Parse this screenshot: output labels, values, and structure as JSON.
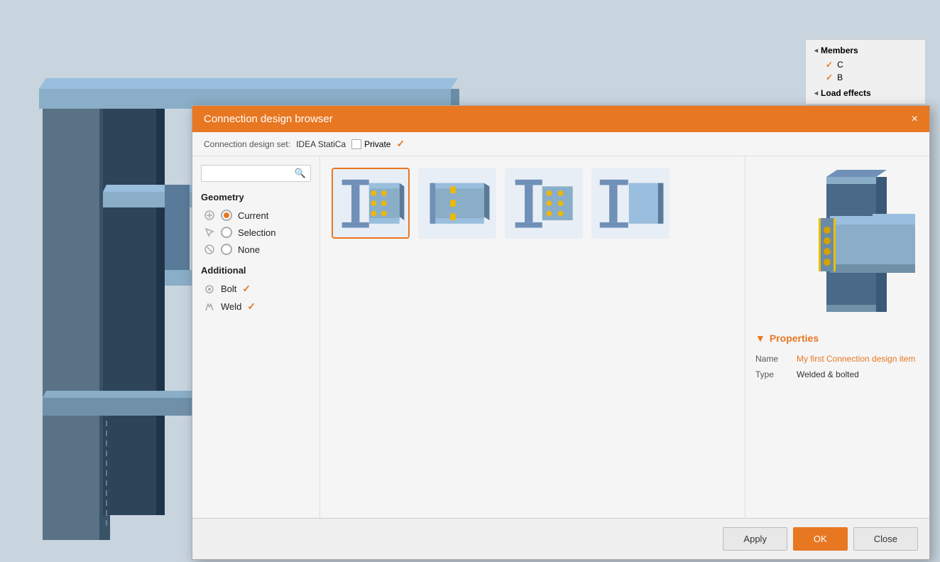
{
  "scene": {
    "bg_color": "#c8d4de"
  },
  "right_panel": {
    "title": "Members",
    "items": [
      {
        "label": "C",
        "checked": true
      },
      {
        "label": "B",
        "checked": true
      }
    ],
    "load_effects": "Load effects"
  },
  "dialog": {
    "title": "Connection design browser",
    "close_label": "×",
    "toolbar": {
      "label": "Connection design set:",
      "value": "IDEA StatiCa",
      "private_label": "Private",
      "checked": true
    },
    "filter": {
      "search_placeholder": "",
      "geometry_title": "Geometry",
      "items": [
        {
          "label": "Current",
          "selected": true
        },
        {
          "label": "Selection",
          "selected": false
        },
        {
          "label": "None",
          "selected": false
        }
      ],
      "additional_title": "Additional",
      "additional_items": [
        {
          "label": "Bolt",
          "checked": true
        },
        {
          "label": "Weld",
          "checked": true
        }
      ]
    },
    "thumbnails": [
      {
        "id": 0,
        "selected": true
      },
      {
        "id": 1,
        "selected": false
      },
      {
        "id": 2,
        "selected": false
      },
      {
        "id": 3,
        "selected": false
      }
    ],
    "properties": {
      "title": "Properties",
      "name_label": "Name",
      "name_value": "My first Connection design item",
      "type_label": "Type",
      "type_value": "Welded & bolted"
    },
    "footer": {
      "apply_label": "Apply",
      "ok_label": "OK",
      "close_label": "Close"
    }
  }
}
